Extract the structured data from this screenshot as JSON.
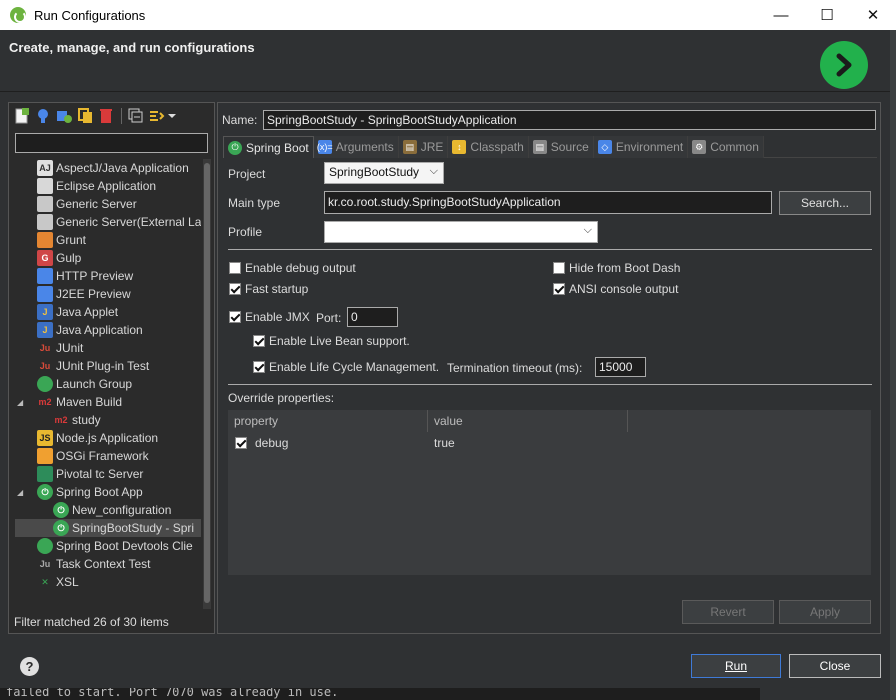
{
  "window": {
    "title": "Run Configurations",
    "minimize": "—",
    "maximize": "☐",
    "close": "✕"
  },
  "banner": {
    "heading": "Create, manage, and run configurations"
  },
  "left": {
    "status": "Filter matched 26 of 30 items",
    "tree": [
      {
        "label": "AspectJ/Java Application",
        "icon": "aspectj-icon",
        "level": 1
      },
      {
        "label": "Eclipse Application",
        "icon": "eclipse-app-icon",
        "level": 1
      },
      {
        "label": "Generic Server",
        "icon": "server-icon",
        "level": 1
      },
      {
        "label": "Generic Server(External La",
        "icon": "server-icon",
        "level": 1
      },
      {
        "label": "Grunt",
        "icon": "grunt-icon",
        "level": 1
      },
      {
        "label": "Gulp",
        "icon": "gulp-icon",
        "level": 1
      },
      {
        "label": "HTTP Preview",
        "icon": "http-preview-icon",
        "level": 1
      },
      {
        "label": "J2EE Preview",
        "icon": "j2ee-preview-icon",
        "level": 1
      },
      {
        "label": "Java Applet",
        "icon": "java-applet-icon",
        "level": 1
      },
      {
        "label": "Java Application",
        "icon": "java-app-icon",
        "level": 1
      },
      {
        "label": "JUnit",
        "icon": "junit-icon",
        "level": 1
      },
      {
        "label": "JUnit Plug-in Test",
        "icon": "junit-plugin-icon",
        "level": 1
      },
      {
        "label": "Launch Group",
        "icon": "launch-group-icon",
        "level": 1
      },
      {
        "label": "Maven Build",
        "icon": "maven-icon",
        "level": 1,
        "expanded": true
      },
      {
        "label": "study",
        "icon": "maven-icon",
        "level": 2
      },
      {
        "label": "Node.js Application",
        "icon": "nodejs-icon",
        "level": 1
      },
      {
        "label": "OSGi Framework",
        "icon": "osgi-icon",
        "level": 1
      },
      {
        "label": "Pivotal tc Server",
        "icon": "pivotal-icon",
        "level": 1
      },
      {
        "label": "Spring Boot App",
        "icon": "spring-boot-icon",
        "level": 1,
        "expanded": true
      },
      {
        "label": "New_configuration",
        "icon": "spring-boot-icon",
        "level": 2
      },
      {
        "label": "SpringBootStudy - Spri",
        "icon": "spring-boot-icon",
        "level": 2,
        "selected": true
      },
      {
        "label": "Spring Boot Devtools Clie",
        "icon": "devtools-icon",
        "level": 1
      },
      {
        "label": "Task Context Test",
        "icon": "task-context-icon",
        "level": 1
      },
      {
        "label": "XSL",
        "icon": "xsl-icon",
        "level": 1
      }
    ]
  },
  "right": {
    "name_label": "Name:",
    "name_value": "SpringBootStudy - SpringBootStudyApplication",
    "tabs": [
      {
        "label": "Spring Boot",
        "icon": "spring-boot-icon",
        "active": true
      },
      {
        "label": "Arguments",
        "icon": "arguments-icon"
      },
      {
        "label": "JRE",
        "icon": "jre-icon"
      },
      {
        "label": "Classpath",
        "icon": "classpath-icon"
      },
      {
        "label": "Source",
        "icon": "source-icon"
      },
      {
        "label": "Environment",
        "icon": "environment-icon"
      },
      {
        "label": "Common",
        "icon": "common-icon"
      }
    ],
    "project_label": "Project",
    "project_value": "SpringBootStudy",
    "main_type_label": "Main type",
    "main_type_value": "kr.co.root.study.SpringBootStudyApplication",
    "search_button": "Search...",
    "profile_label": "Profile",
    "profile_value": "",
    "enable_debug_output": "Enable debug output",
    "hide_from_boot_dash": "Hide from Boot Dash",
    "fast_startup": "Fast startup",
    "ansi_console_output": "ANSI console output",
    "enable_jmx": "Enable JMX",
    "port_label": "Port:",
    "port_value": "0",
    "enable_live_bean": "Enable Live Bean support.",
    "enable_life_cycle": "Enable Life Cycle Management.",
    "termination_label": "Termination timeout (ms):",
    "termination_value": "15000",
    "override_label": "Override properties:",
    "table": {
      "headers": [
        "property",
        "value"
      ],
      "rows": [
        {
          "property": "debug",
          "value": "true",
          "checked": true
        }
      ]
    },
    "revert_button": "Revert",
    "apply_button": "Apply"
  },
  "bottom": {
    "help": "?",
    "run_button": "Run",
    "close_button": "Close",
    "console_text": "failed to start. Port 7070 was already in use."
  },
  "colors": {
    "spring_green": "#6db33f",
    "run_green": "#22b14c"
  }
}
